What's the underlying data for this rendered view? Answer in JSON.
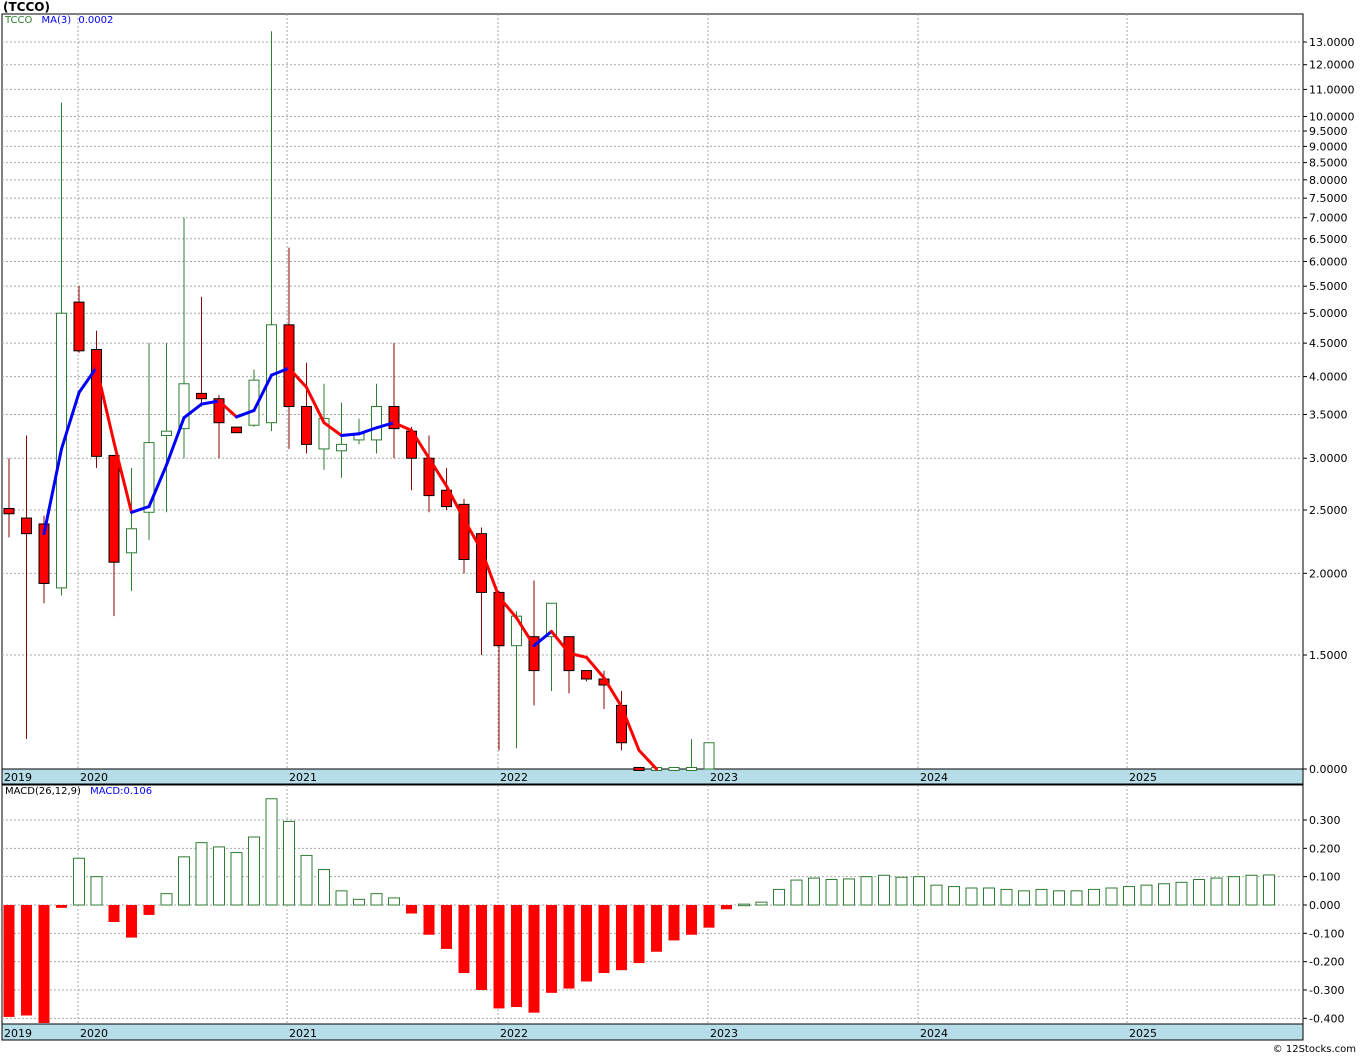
{
  "title": "(TCCO)",
  "credit": "© 12Stocks.com",
  "colors": {
    "up": "#2e7d32",
    "down": "#ff0000",
    "ma_up": "#0000ff",
    "ma_down": "#ff0000",
    "axis_band": "#b7dde8",
    "grid": "#a8a8a8"
  },
  "price_panel": {
    "legend": {
      "ticker": "TCCO",
      "ma_label": "MA(3)",
      "ma_value": "0.0002"
    },
    "scale": "log",
    "y_ticks": [
      "13.0000",
      "12.0000",
      "11.0000",
      "10.0000",
      "9.5000",
      "9.0000",
      "8.5000",
      "8.0000",
      "7.5000",
      "7.0000",
      "6.5000",
      "6.0000",
      "5.5000",
      "5.0000",
      "4.5000",
      "4.0000",
      "3.5000",
      "3.0000",
      "2.5000",
      "2.0000",
      "1.5000",
      "0.0000"
    ],
    "x_labels": [
      "2019",
      "2020",
      "2021",
      "2022",
      "2023",
      "2024",
      "2025"
    ]
  },
  "macd_panel": {
    "legend": {
      "label": "MACD(26,12,9)",
      "value_label": "MACD:0.106"
    },
    "y_ticks": [
      "0.300",
      "0.200",
      "0.100",
      "0.000",
      "-0.100",
      "-0.200",
      "-0.300",
      "-0.400"
    ],
    "x_labels": [
      "2019",
      "2020",
      "2021",
      "2022",
      "2023",
      "2024",
      "2025"
    ]
  },
  "chart_data": [
    {
      "type": "candlestick",
      "title": "(TCCO)",
      "scale": "log",
      "interval": "monthly",
      "x_labels": [
        "2019",
        "2020",
        "2021",
        "2022",
        "2023",
        "2024",
        "2025"
      ],
      "candles": [
        {
          "o": 2.5,
          "h": 3.0,
          "l": 2.27,
          "c": 2.48
        },
        {
          "o": 2.43,
          "h": 3.25,
          "l": 0.8,
          "c": 2.3
        },
        {
          "o": 2.38,
          "h": 2.45,
          "l": 1.8,
          "c": 1.93
        },
        {
          "o": 1.9,
          "h": 10.5,
          "l": 1.85,
          "c": 5.0
        },
        {
          "o": 5.2,
          "h": 5.5,
          "l": 4.35,
          "c": 4.38
        },
        {
          "o": 4.4,
          "h": 4.7,
          "l": 2.9,
          "c": 3.02
        },
        {
          "o": 3.03,
          "h": 3.03,
          "l": 1.72,
          "c": 2.08
        },
        {
          "o": 2.15,
          "h": 2.9,
          "l": 1.88,
          "c": 2.34
        },
        {
          "o": 2.48,
          "h": 4.5,
          "l": 2.25,
          "c": 3.17
        },
        {
          "o": 3.25,
          "h": 4.5,
          "l": 2.48,
          "c": 3.3
        },
        {
          "o": 3.33,
          "h": 7.0,
          "l": 3.0,
          "c": 3.9
        },
        {
          "o": 3.77,
          "h": 5.3,
          "l": 3.6,
          "c": 3.7
        },
        {
          "o": 3.7,
          "h": 3.75,
          "l": 3.0,
          "c": 3.4
        },
        {
          "o": 3.33,
          "h": 3.33,
          "l": 3.3,
          "c": 3.3
        },
        {
          "o": 3.37,
          "h": 4.1,
          "l": 3.35,
          "c": 3.95
        },
        {
          "o": 3.4,
          "h": 13.5,
          "l": 3.3,
          "c": 4.8
        },
        {
          "o": 4.8,
          "h": 6.3,
          "l": 3.1,
          "c": 3.6
        },
        {
          "o": 3.6,
          "h": 4.2,
          "l": 3.05,
          "c": 3.15
        },
        {
          "o": 3.1,
          "h": 3.9,
          "l": 2.88,
          "c": 3.45
        },
        {
          "o": 3.08,
          "h": 3.65,
          "l": 2.8,
          "c": 3.15
        },
        {
          "o": 3.2,
          "h": 3.45,
          "l": 3.15,
          "c": 3.27
        },
        {
          "o": 3.2,
          "h": 3.9,
          "l": 3.05,
          "c": 3.6
        },
        {
          "o": 3.6,
          "h": 4.5,
          "l": 3.0,
          "c": 3.33
        },
        {
          "o": 3.3,
          "h": 3.35,
          "l": 2.68,
          "c": 3.0
        },
        {
          "o": 3.0,
          "h": 3.25,
          "l": 2.48,
          "c": 2.63
        },
        {
          "o": 2.68,
          "h": 2.9,
          "l": 2.5,
          "c": 2.53
        },
        {
          "o": 2.55,
          "h": 2.6,
          "l": 2.0,
          "c": 2.1
        },
        {
          "o": 2.3,
          "h": 2.35,
          "l": 1.5,
          "c": 1.87
        },
        {
          "o": 1.87,
          "h": 1.88,
          "l": 0.5,
          "c": 1.55
        },
        {
          "o": 1.55,
          "h": 1.75,
          "l": 0.55,
          "c": 1.72
        },
        {
          "o": 1.6,
          "h": 1.95,
          "l": 1.08,
          "c": 1.37
        },
        {
          "o": 1.6,
          "h": 1.8,
          "l": 1.2,
          "c": 1.8
        },
        {
          "o": 1.6,
          "h": 1.6,
          "l": 1.18,
          "c": 1.37
        },
        {
          "o": 1.37,
          "h": 1.37,
          "l": 1.28,
          "c": 1.3
        },
        {
          "o": 1.3,
          "h": 1.37,
          "l": 1.05,
          "c": 1.25
        },
        {
          "o": 1.08,
          "h": 1.2,
          "l": 0.5,
          "c": 0.7
        },
        {
          "o": 0.001,
          "h": 0.001,
          "l": 0.0001,
          "c": 0.0002
        },
        {
          "o": 0.0002,
          "h": 0.0002,
          "l": 0.0001,
          "c": 0.0002
        },
        {
          "o": 0.0002,
          "h": 0.0002,
          "l": 0.0001,
          "c": 0.0002
        },
        {
          "o": 0.0002,
          "h": 0.8,
          "l": 0.0001,
          "c": 0.0003
        },
        {
          "o": 0.0002,
          "h": 0.7,
          "l": 0.0001,
          "c": 0.7
        }
      ],
      "ma3": [
        null,
        null,
        2.3,
        3.1,
        3.78,
        4.13,
        3.17,
        2.48,
        2.53,
        2.93,
        3.46,
        3.63,
        3.67,
        3.47,
        3.55,
        4.02,
        4.12,
        3.85,
        3.4,
        3.25,
        3.27,
        3.34,
        3.4,
        3.31,
        3.0,
        2.72,
        2.42,
        2.17,
        1.84,
        1.71,
        1.55,
        1.63,
        1.51,
        1.48,
        1.31,
        1.07,
        0.5,
        0.0002
      ]
    },
    {
      "type": "bar",
      "title": "MACD(26,12,9)",
      "ylim": [
        -0.4,
        0.37
      ],
      "x_labels": [
        "2019",
        "2020",
        "2021",
        "2022",
        "2023",
        "2024",
        "2025"
      ],
      "values": [
        -0.395,
        -0.39,
        -0.42,
        -0.01,
        0.165,
        0.1,
        -0.06,
        -0.115,
        -0.035,
        0.04,
        0.17,
        0.22,
        0.205,
        0.185,
        0.24,
        0.375,
        0.295,
        0.175,
        0.125,
        0.05,
        0.02,
        0.04,
        0.025,
        -0.03,
        -0.105,
        -0.155,
        -0.24,
        -0.3,
        -0.365,
        -0.36,
        -0.38,
        -0.31,
        -0.295,
        -0.27,
        -0.24,
        -0.23,
        -0.205,
        -0.165,
        -0.125,
        -0.105,
        -0.08,
        -0.015,
        0.003,
        0.01,
        0.055,
        0.088,
        0.095,
        0.09,
        0.092,
        0.1,
        0.105,
        0.098,
        0.1,
        0.07,
        0.065,
        0.06,
        0.06,
        0.055,
        0.05,
        0.055,
        0.05,
        0.05,
        0.055,
        0.06,
        0.065,
        0.07,
        0.075,
        0.08,
        0.09,
        0.095,
        0.1,
        0.105,
        0.106
      ]
    }
  ]
}
